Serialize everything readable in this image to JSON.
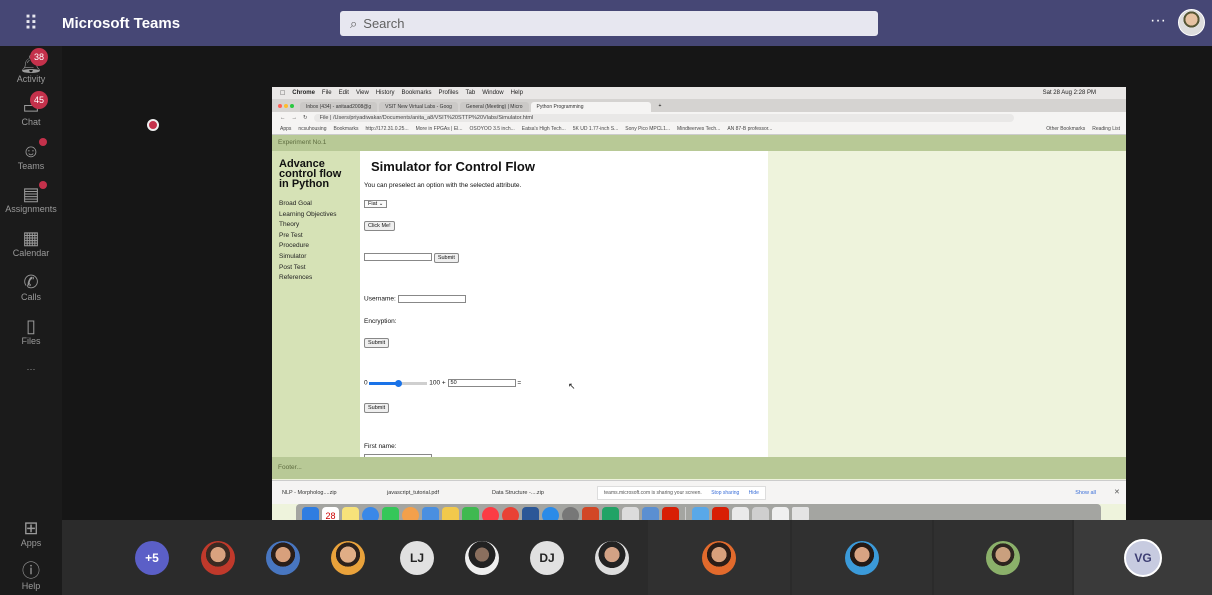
{
  "teams": {
    "app_title": "Microsoft Teams",
    "search_placeholder": "Search",
    "more": "···",
    "rail": [
      {
        "label": "Activity",
        "badge": "38",
        "icon": "bell-icon"
      },
      {
        "label": "Chat",
        "badge": "45",
        "icon": "chat-icon"
      },
      {
        "label": "Teams",
        "badge": "",
        "icon": "teams-icon"
      },
      {
        "label": "Assignments",
        "badge": "",
        "icon": "assignments-icon"
      },
      {
        "label": "Calendar",
        "badge": "",
        "icon": "calendar-icon"
      },
      {
        "label": "Calls",
        "badge": "",
        "icon": "calls-icon"
      },
      {
        "label": "Files",
        "badge": "",
        "icon": "files-icon"
      },
      {
        "label": "···",
        "badge": "",
        "icon": "more-icon"
      },
      {
        "label": "Apps",
        "badge": "",
        "icon": "apps-icon"
      },
      {
        "label": "Help",
        "badge": "",
        "icon": "help-icon"
      }
    ],
    "accent": "#464775"
  },
  "mac": {
    "menubar": [
      "Chrome",
      "File",
      "Edit",
      "View",
      "History",
      "Bookmarks",
      "Profiles",
      "Tab",
      "Window",
      "Help"
    ],
    "clock": "Sat 28 Aug 2:28 PM"
  },
  "browser": {
    "tabs": [
      "Inbox (434) - anitaad2008@g",
      "VSIT New Virtual Labs - Goog",
      "General (Meeting) | Micro",
      "Python Programming"
    ],
    "url": "File | /Users/priyadiwakar/Documents/anita_a8/VSIT%20STTP%20Vlabs/Simulator.html",
    "bookmarks": [
      "Apps",
      "ncsuhousing",
      "Bookmarks",
      "http://172.31.0.25...",
      "More in FPGAs | El...",
      "OSOYOO 3.5 inch...",
      "Eatsa's High Tech...",
      "5K UD 1.77-inch S...",
      "Sony Pico MPCL1...",
      "Mindteerves Tech...",
      "AN 87-B professor...",
      "Other Bookmarks",
      "Reading List"
    ]
  },
  "lab": {
    "experiment": "Experiment No.1",
    "side_title": "Advance control flow in Python",
    "links": [
      "Broad Goal",
      "Learning Objectives",
      "Theory",
      "Pre Test",
      "Procedure",
      "Simulator",
      "Post Test",
      "References"
    ],
    "title": "Simulator for Control Flow",
    "intro": "You can preselect an option with the selected attribute.",
    "select_value": "Fiat",
    "click_me": "Click Me!",
    "submit": "Submit",
    "username_label": "Username:",
    "encryption_label": "Encryption:",
    "slider_min": "0",
    "slider_max": "100 +",
    "slider_value": "50",
    "slider_result": "=",
    "slider_level": 0.5,
    "first_name_label": "First name:",
    "footer": "Footer..."
  },
  "downloads": {
    "items": [
      "NLP - Morpholog....zip",
      "javascript_tutorial.pdf",
      "Data Structure -....zip"
    ],
    "notice": "teams.microsoft.com is sharing your screen.",
    "stop": "Stop sharing",
    "hide": "Hide",
    "show_all": "Show all"
  },
  "dock": {
    "calendar_day": "28"
  },
  "call": {
    "overflow": "+5",
    "initials_a": "LJ",
    "initials_b": "DJ",
    "self_initials": "VG"
  }
}
